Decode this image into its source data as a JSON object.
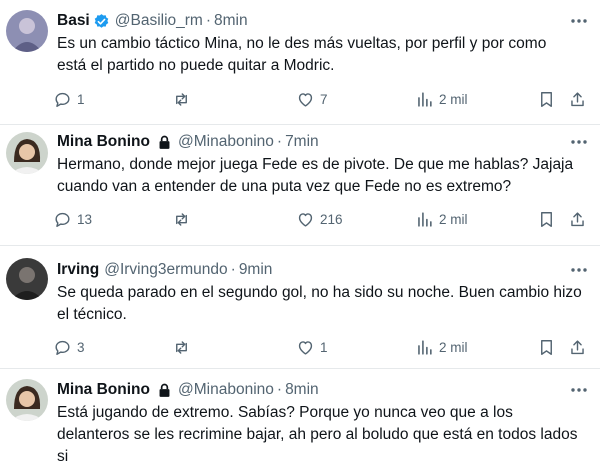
{
  "icons": {
    "reply": "reply-icon",
    "retweet": "retweet-icon",
    "like": "heart-icon",
    "views": "views-icon",
    "bookmark": "bookmark-icon",
    "share": "share-icon",
    "more": "more-icon",
    "verified": "verified-badge-icon",
    "lock": "lock-icon"
  },
  "colors": {
    "verified": "#1d9bf0",
    "muted": "#536471",
    "text": "#0f1419"
  },
  "tweets": [
    {
      "name": "Basi",
      "handle": "@Basilio_rm",
      "sep": "·",
      "time": "8min",
      "verified": true,
      "locked": false,
      "lines": [
        "Es un cambio táctico Mina, no le des más vueltas, por perfil y por como",
        "está el partido no puede quitar a Modric."
      ],
      "replies": "1",
      "retweets": "",
      "likes": "7",
      "views": "2 mil"
    },
    {
      "name": "Mina Bonino",
      "handle": "@Minabonino",
      "sep": "·",
      "time": "7min",
      "verified": false,
      "locked": true,
      "lines": [
        "Hermano, donde mejor juega Fede es de pivote. De que me hablas? Jajaja",
        "cuando van a entender de una puta vez que Fede no es extremo?"
      ],
      "replies": "13",
      "retweets": "",
      "likes": "216",
      "views": "2 mil"
    },
    {
      "name": "Irving",
      "handle": "@Irving3ermundo",
      "sep": "·",
      "time": "9min",
      "verified": false,
      "locked": false,
      "lines": [
        "Se queda parado en el segundo gol, no ha sido su noche. Buen cambio hizo",
        "el técnico."
      ],
      "replies": "3",
      "retweets": "",
      "likes": "1",
      "views": "2 mil"
    },
    {
      "name": "Mina Bonino",
      "handle": "@Minabonino",
      "sep": "·",
      "time": "8min",
      "verified": false,
      "locked": true,
      "lines": [
        "Está jugando de extremo. Sabías? Porque yo nunca veo que a los",
        "delanteros se les recrimine bajar, ah pero al boludo que está en todos lados",
        "si"
      ]
    }
  ]
}
